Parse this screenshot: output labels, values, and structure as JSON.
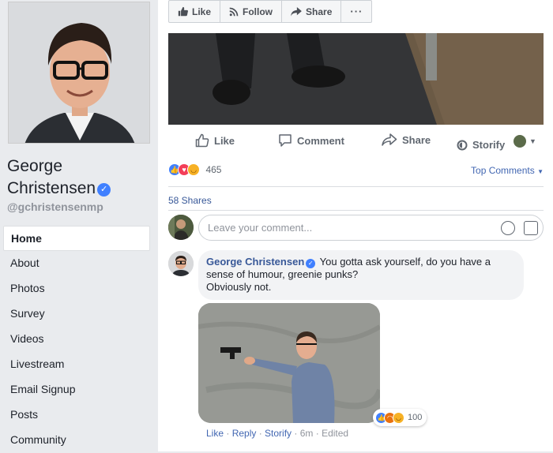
{
  "profile": {
    "name_line1": "George",
    "name_line2": "Christensen",
    "handle": "@gchristensenmp",
    "verified_icon": "verified-check-icon"
  },
  "nav": {
    "items": [
      {
        "label": "Home",
        "active": true
      },
      {
        "label": "About"
      },
      {
        "label": "Photos"
      },
      {
        "label": "Survey"
      },
      {
        "label": "Videos"
      },
      {
        "label": "Livestream"
      },
      {
        "label": "Email Signup"
      },
      {
        "label": "Posts"
      },
      {
        "label": "Community"
      }
    ]
  },
  "top_actions": {
    "like": "Like",
    "follow": "Follow",
    "share": "Share",
    "more": "···"
  },
  "post_actions": {
    "like": "Like",
    "comment": "Comment",
    "share": "Share",
    "storify": "Storify"
  },
  "reactions": {
    "count": "465",
    "sort_label": "Top Comments"
  },
  "shares": "58 Shares",
  "comment_input": {
    "placeholder": "Leave your comment..."
  },
  "comment": {
    "author": "George Christensen",
    "text_line1": "You gotta ask yourself, do you have a",
    "text_line2": "sense of humour, greenie punks?",
    "text_line3": "Obviously not.",
    "reaction_count": "100",
    "meta": {
      "like": "Like",
      "reply": "Reply",
      "storify": "Storify",
      "time": "6m",
      "edited": "Edited"
    }
  },
  "colors": {
    "fb_blue": "#4267b2",
    "link_blue": "#385898",
    "page_bg": "#e9ebee"
  }
}
